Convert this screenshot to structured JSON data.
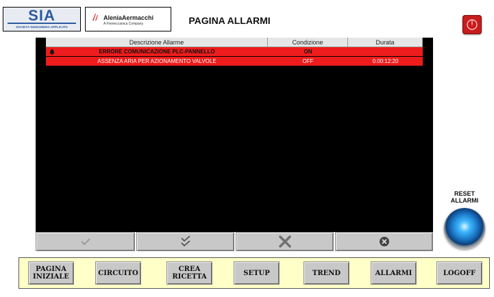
{
  "header": {
    "logo_sia": {
      "big": "SIA",
      "small": "SOCIETÀ INGEGNERIA APPLICATA"
    },
    "logo_alenia": {
      "name": "AleniaAermacchi",
      "sub": "A Finmeccanica Company"
    },
    "title": "PAGINA ALLARMI"
  },
  "alarm_table": {
    "columns": [
      "Descrizione Allarme",
      "Condizione",
      "Durata"
    ],
    "rows": [
      {
        "description": "ERRORE COMUNICAZIONE PLC-PANNELLO",
        "condition": "ON",
        "duration": ""
      },
      {
        "description": "ASSENZA ARIA PER AZIONAMENTO VALVOLE",
        "condition": "OFF",
        "duration": "0.00:12:20"
      }
    ]
  },
  "action_buttons": [
    {
      "icon": "check-icon"
    },
    {
      "icon": "double-check-icon"
    },
    {
      "icon": "x-icon"
    },
    {
      "icon": "close-circle-icon"
    }
  ],
  "reset": {
    "label": "RESET\nALLARMI"
  },
  "nav": [
    {
      "label": "PAGINA\nINIZIALE"
    },
    {
      "label": "CIRCUITO"
    },
    {
      "label": "CREA\nRICETTA"
    },
    {
      "label": "SETUP"
    },
    {
      "label": "TREND"
    },
    {
      "label": "ALLARMI"
    },
    {
      "label": "LOGOFF"
    }
  ],
  "colors": {
    "alarm_red": "#ee1c1c",
    "nav_background": "#ffffc8",
    "button_gray": "#c8c8c8",
    "reset_blue": "#1b78c8",
    "power_red": "#c81d1d"
  }
}
